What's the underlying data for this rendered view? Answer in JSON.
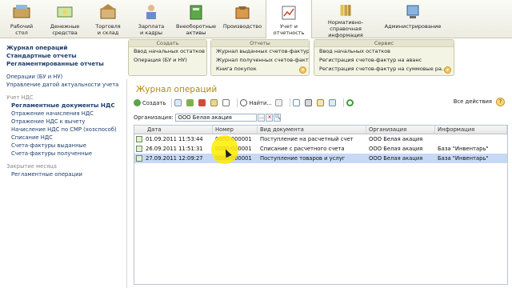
{
  "sections": [
    {
      "label": "Рабочий\nстол",
      "icon": "desktop-icon"
    },
    {
      "label": "Денежные\nсредства",
      "icon": "money-icon"
    },
    {
      "label": "Торговля\nи склад",
      "icon": "warehouse-icon"
    },
    {
      "label": "Зарплата\nи кадры",
      "icon": "salary-icon"
    },
    {
      "label": "Внеоборотные\nактивы",
      "icon": "assets-icon"
    },
    {
      "label": "Производство",
      "icon": "production-icon"
    },
    {
      "label": "Учет и\nотчетность",
      "icon": "accounting-icon"
    },
    {
      "label": "Нормативно-\nсправочная информация",
      "icon": "reference-icon"
    },
    {
      "label": "Администрирование",
      "icon": "admin-icon"
    }
  ],
  "left_nav": {
    "top_links": [
      "Журнал операций",
      "Стандартные отчеты",
      "Регламентированные отчеты"
    ],
    "links2": [
      "Операции (БУ и НУ)",
      "Управление датой актуальности учета"
    ],
    "vat_group": "Учет НДС",
    "vat_items": [
      "Регламентные документы НДС",
      "Отражение начисления НДС",
      "Отражение НДС к вычету",
      "Начисление НДС по СМР (хозспособ)",
      "Списание НДС",
      "Счета-фактуры выданные",
      "Счета-фактуры полученные"
    ],
    "close_group": "Закрытие месяца",
    "close_items": [
      "Регламентные операции"
    ]
  },
  "panels": {
    "create": {
      "title": "Создать",
      "items": [
        "Ввод начальных остатков",
        "Операция (БУ и НУ)"
      ]
    },
    "reports": {
      "title": "Отчеты",
      "items": [
        "Журнал выданных счетов-фактур",
        "Журнал полученных счетов-фактур",
        "Книга покупок"
      ]
    },
    "service": {
      "title": "Сервис",
      "items": [
        "Ввод начальных остатков",
        "Регистрация счетов-фактур на аванс",
        "Регистрация счетов-фактур на суммовые ра..."
      ]
    }
  },
  "main": {
    "title": "Журнал операций",
    "create_label": "Создать",
    "find_label": "Найти...",
    "all_actions": "Все действия",
    "help": "?",
    "filter_label": "Организация:",
    "filter_value": "ООО Белая акация",
    "columns": [
      "Дата",
      "Номер",
      "Вид документа",
      "Организация",
      "Информация"
    ],
    "rows": [
      {
        "date": "01.09.2011 11:53:44",
        "number": "0000-000001",
        "doc": "Поступление на расчетный счет",
        "org": "ООО Белая акация",
        "info": ""
      },
      {
        "date": "26.09.2011 11:51:31",
        "number": "0000-000001",
        "doc": "Списание с расчетного счета",
        "org": "ООО Белая акация",
        "info": "База \"Инвентарь\""
      },
      {
        "date": "27.09.2011 12:09:27",
        "number": "0000-000001",
        "doc": "Поступление товаров и услуг",
        "org": "ООО Белая акация",
        "info": "База \"Инвентарь\""
      }
    ]
  },
  "colors": {
    "title": "#b7831b",
    "nav": "#1c3d6e",
    "selected_row": "#c6d9f5",
    "highlight": "#ffec00"
  }
}
